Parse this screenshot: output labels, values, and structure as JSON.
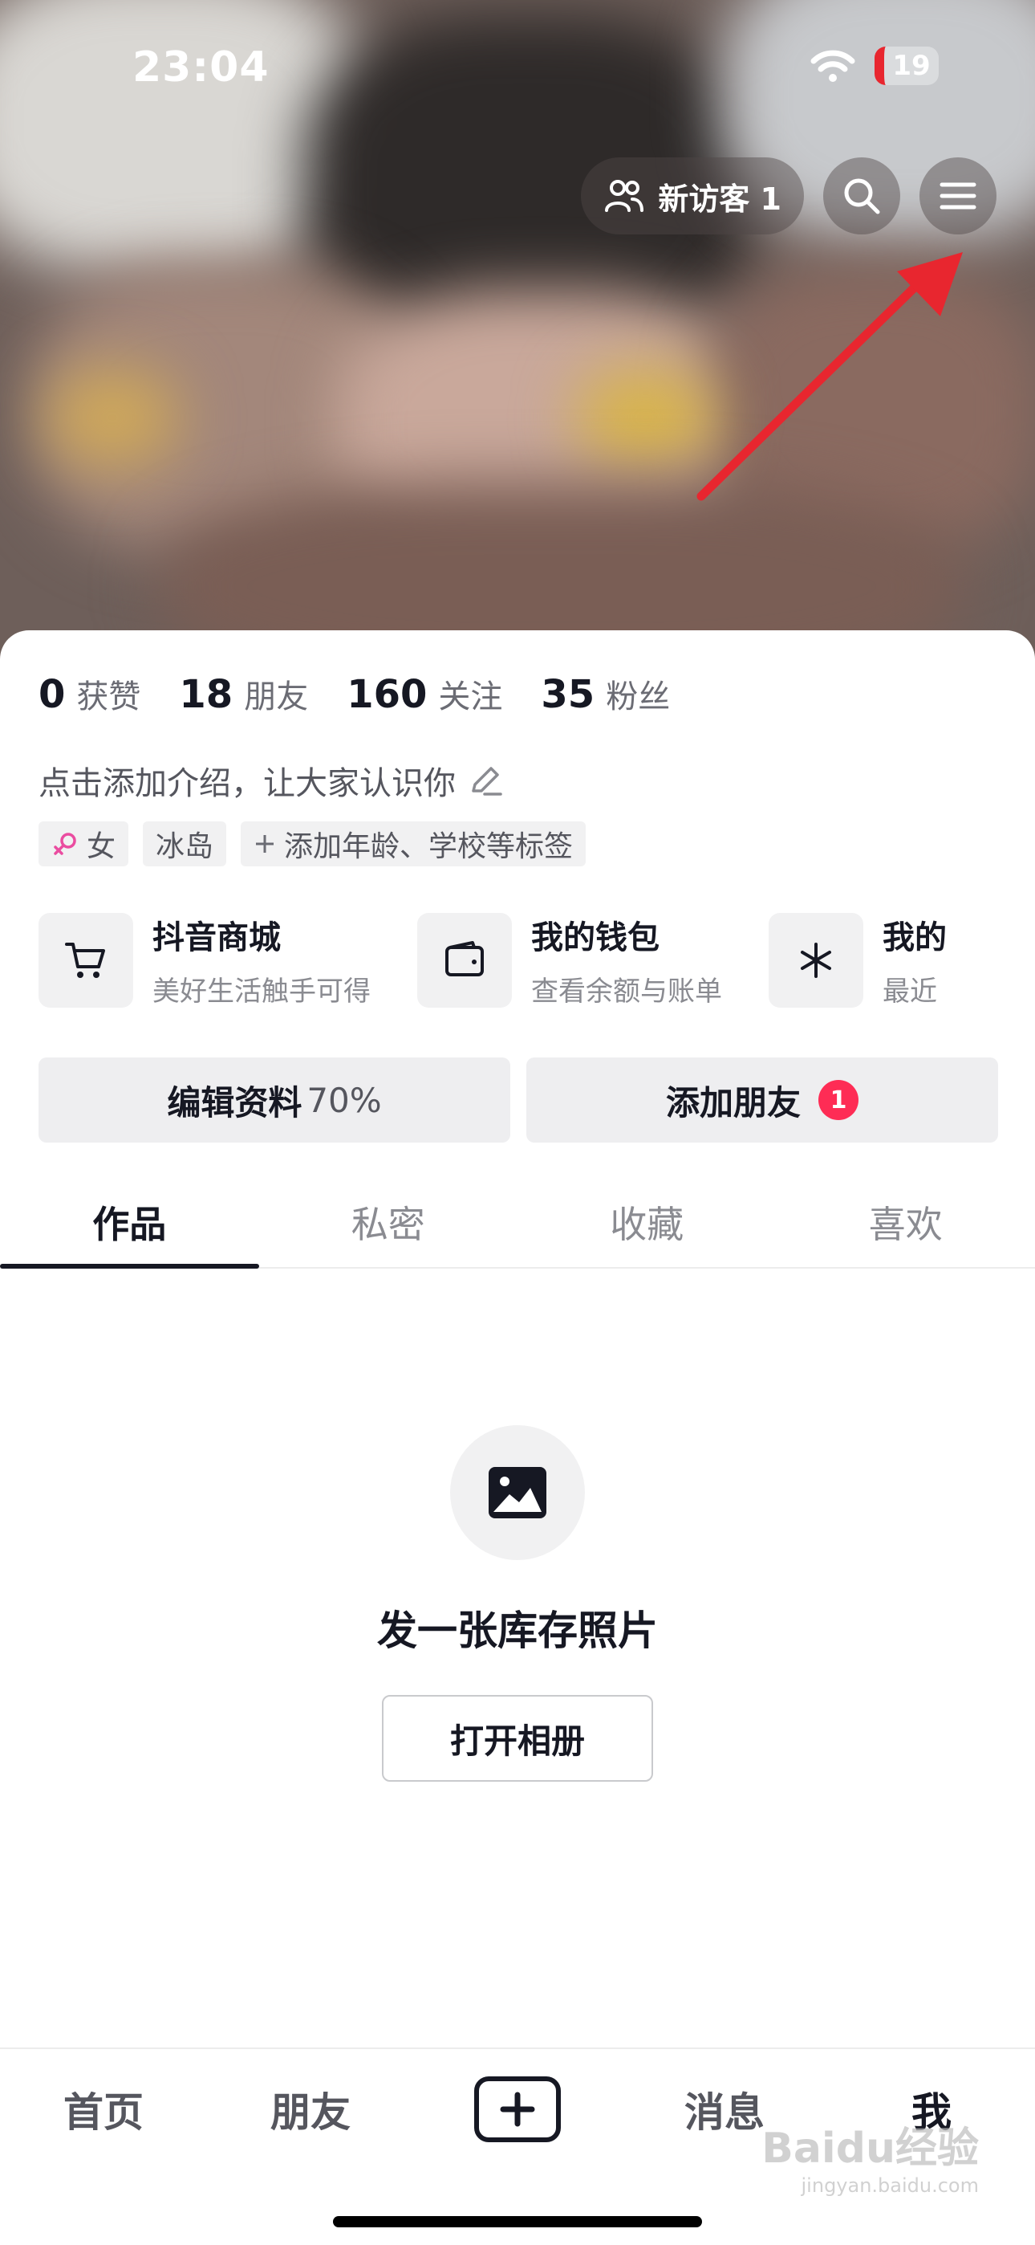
{
  "status_bar": {
    "time": "23:04",
    "battery": "19"
  },
  "header": {
    "visitors_label": "新访客 1"
  },
  "stats": [
    {
      "num": "0",
      "label": "获赞"
    },
    {
      "num": "18",
      "label": "朋友"
    },
    {
      "num": "160",
      "label": "关注"
    },
    {
      "num": "35",
      "label": "粉丝"
    }
  ],
  "bio": {
    "text": "点击添加介绍，让大家认识你"
  },
  "tags": {
    "gender": "女",
    "location": "冰岛",
    "add": "添加年龄、学校等标签"
  },
  "services": [
    {
      "title": "抖音商城",
      "sub": "美好生活触手可得"
    },
    {
      "title": "我的钱包",
      "sub": "查看余额与账单"
    },
    {
      "title": "我的",
      "sub": "最近"
    }
  ],
  "actions": {
    "edit_label": "编辑资料",
    "edit_pct": "70%",
    "add_friend_label": "添加朋友",
    "add_friend_badge": "1"
  },
  "tabs": [
    "作品",
    "私密",
    "收藏",
    "喜欢"
  ],
  "empty": {
    "title": "发一张库存照片",
    "button": "打开相册"
  },
  "bottom_nav": {
    "home": "首页",
    "friends": "朋友",
    "messages": "消息",
    "me": "我"
  },
  "watermark": {
    "main": "Baidu经验",
    "sub": "jingyan.baidu.com"
  },
  "colors": {
    "accent": "#fe2c55",
    "text": "#161823",
    "annotation_arrow": "#e8262f"
  }
}
